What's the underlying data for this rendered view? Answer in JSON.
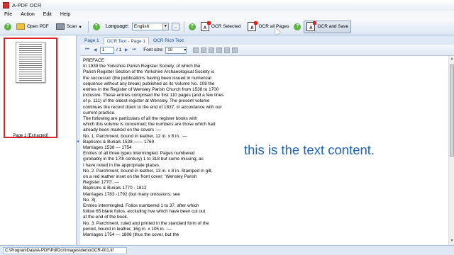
{
  "window": {
    "title": "A-PDF OCR"
  },
  "menu": [
    "File",
    "Action",
    "Edit",
    "Help"
  ],
  "toolbar": {
    "open_label": "Open PDF",
    "scan_label": "Scan",
    "language_label": "Language:",
    "language_value": "English",
    "language_more": "...",
    "ocr_selected_label": "OCR Selected",
    "ocr_all_label": "OCR all Pages",
    "ocr_save_label": "OCR and Save",
    "ocr_icon_glyph": "A"
  },
  "thumbnail": {
    "label": "Page 1 [Extracted]"
  },
  "tabs": [
    "Page 1",
    "OCR Text - Page 1",
    "OCR Rich Text"
  ],
  "nav": {
    "page_value": "1",
    "page_total": "/ 1",
    "font_size_label": "Font size:",
    "font_size_value": "10"
  },
  "ocr_text": "PREFACE\nIn 1939 the Yorkshire Parish Register Society, of which the\nParish Register Section of the Yorkshire Archaeological Society is\nthe successor (the publications having been issued in numerical\nsequence without any break) published as its Volume No. 108 the\nentries in the Register of Wensley Parish Church from 1538 to 1700\ninclusive. These entries comprised the first 110 pages (and a few lines\nof p. 111) of the oldest register at Wensley. The present volume\ncontinues the record down to the end of 1837, in accordance with our\ncurrent practice.\nThe following are particulars of all the register books with\nwhich this volume is concerned; the numbers are those which had\nalready been marked on the covers :—\nNo. 1. Parchment, bound in leather, 12 in. x 8 in. :—\nBaptisms & Burials 1538 —— 1769\nMarriages 1538 — 1754\nEntries of all three types intermingled. Pages numbered\n(probably in the 17th century) 1 to 318 but some missing, as\nI have noted in the appropriate places.\nNo. 2. Parchment, bound in leather, 13 in. x 8 in. Stamped in gilt,\non a red leather inset on the front cover: 'Wensley Parish\nRegister 1770'.:—\nBaptisms & Burials 1770 - 1812\nMarriages 1783 -1792 (but many omissions; see\nNo. 3).\nEntries intermingled. Folios numbered 1 to 37, after which\nfollow 65 blank folios, excluding hve which have been cut out\nat the end of the book.\nNo. 3. Parchment, ruled and printed in the standard form of the\nperiod, bound in leather, 16g in. x 105 in. :—\nMarriages 1754 — 1806 (thus the cover, but the",
  "overlay_caption": "this is the text content.",
  "status": {
    "path": "C:\\ProgramData\\A-PDF\\PdfOcr\\Images\\demoOCR-001.tif"
  }
}
